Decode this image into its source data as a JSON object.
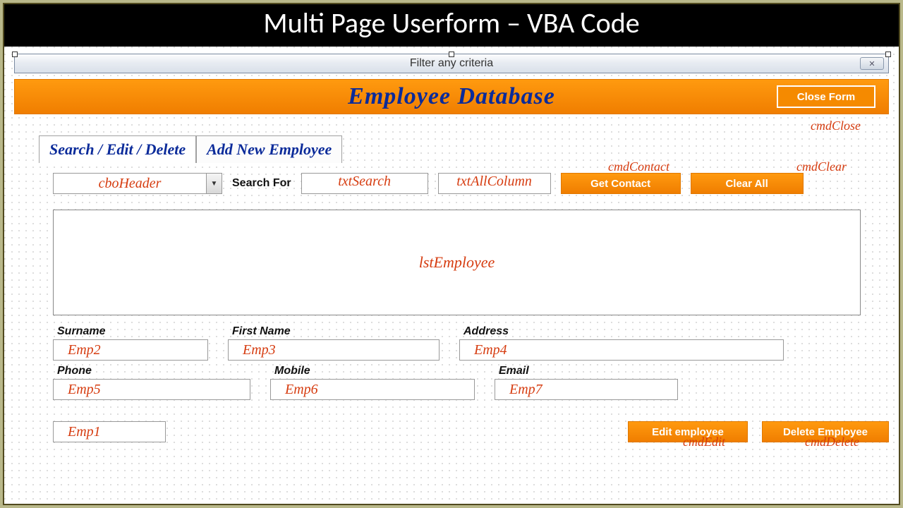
{
  "slide_title": "Multi Page Userform – VBA Code",
  "window": {
    "title": "Filter any criteria",
    "close_glyph": "✕"
  },
  "header": {
    "title": "Employee Database",
    "close_form": "Close Form"
  },
  "tabs": {
    "search": "Search / Edit / Delete",
    "add": "Add New Employee"
  },
  "search": {
    "combo_placeholder": "cboHeader",
    "search_for_label": "Search For",
    "txt_search_placeholder": "txtSearch",
    "txt_allcol_placeholder": "txtAllColumn",
    "get_contact": "Get Contact",
    "clear_all": "Clear All"
  },
  "listbox": {
    "name": "lstEmployee"
  },
  "fields": {
    "surname_label": "Surname",
    "surname_val": "Emp2",
    "first_label": "First Name",
    "first_val": "Emp3",
    "address_label": "Address",
    "address_val": "Emp4",
    "phone_label": "Phone",
    "phone_val": "Emp5",
    "mobile_label": "Mobile",
    "mobile_val": "Emp6",
    "email_label": "Email",
    "email_val": "Emp7",
    "emp1_val": "Emp1"
  },
  "buttons": {
    "edit": "Edit employee",
    "delete": "Delete Employee"
  },
  "annotations": {
    "cmdClose": "cmdClose",
    "cmdContact": "cmdContact",
    "cmdClear": "cmdClear",
    "cmdEdit": "cmdEdit",
    "cmdDelete": "cmdDelete"
  }
}
